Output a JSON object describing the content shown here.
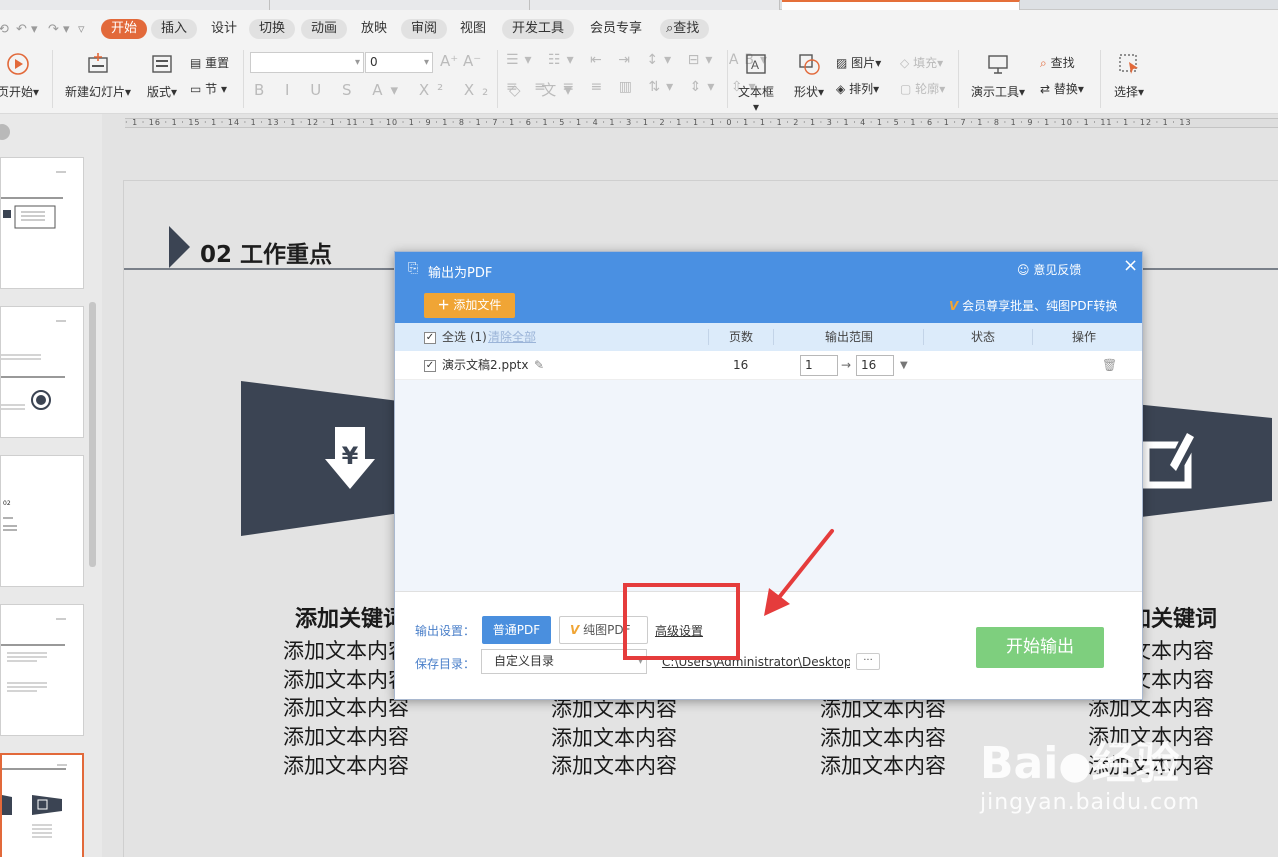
{
  "ribbon_tabs": [
    "开始",
    "插入",
    "设计",
    "切换",
    "动画",
    "放映",
    "审阅",
    "视图",
    "开发工具",
    "会员专享",
    "查找"
  ],
  "ribbon": {
    "slideshow_partial": "页开始",
    "new_slide": "新建幻灯片",
    "layout": "版式",
    "reset": "重置",
    "section": "节",
    "font_size_value": "0",
    "text_box": "文本框",
    "shape": "形状",
    "picture": "图片",
    "fill": "填充",
    "arrange": "排列",
    "outline": "轮廓",
    "presentation_tools": "演示工具",
    "find": "查找",
    "replace": "替换",
    "select": "选择"
  },
  "ruler_text": "· 1 · 16 · 1 · 15 · 1 · 14 · 1 · 13 · 1 · 12 · 1 · 11 · 1 · 10 · 1 · 9 · 1 · 8 · 1 · 7 · 1 · 6 · 1 · 5 · 1 · 4 · 1 · 3 · 1 · 2 · 1 · 1 · 1 · 0 · 1 · 1 · 1 · 2 · 1 · 3 · 1 · 4 · 1 · 5 · 1 · 6 · 1 · 7 · 1 · 8 · 1 · 9 · 1 · 10 · 1 · 11 · 1 · 12 · 1 · 13",
  "slide": {
    "title": "02  工作重点",
    "keyword_left": "添加关键词",
    "keyword_right": "加关键词",
    "body_line": "添加文本内容"
  },
  "dialog": {
    "title": "输出为PDF",
    "feedback": "意见反馈",
    "close": "×",
    "add_file": "添加文件",
    "vip_promo": "会员尊享批量、纯图PDF转换",
    "headers": {
      "select_all": "全选 (1)",
      "clear_all": "清除全部",
      "pages": "页数",
      "range": "输出范围",
      "status": "状态",
      "action": "操作"
    },
    "file": {
      "name": "演示文稿2.pptx",
      "pages": "16",
      "range_from": "1",
      "range_to": "16"
    },
    "footer": {
      "output_settings_label": "输出设置：",
      "normal_pdf": "普通PDF",
      "image_pdf": "纯图PDF",
      "advanced": "高级设置",
      "save_dir_label": "保存目录：",
      "save_dir_value": "自定义目录",
      "save_path": "C:\\Users\\Administrator\\Desktop\\",
      "browse": "···",
      "start": "开始输出"
    }
  },
  "watermark": {
    "brand": "Bai",
    "brand_tail": "经验",
    "url": "jingyan.baidu.com"
  },
  "colors": {
    "accent_orange": "#e2693a",
    "dialog_blue": "#4a90e2",
    "slide_dark": "#3b4453",
    "start_green": "#7ecf7e",
    "annotation_red": "#e53c3c"
  }
}
